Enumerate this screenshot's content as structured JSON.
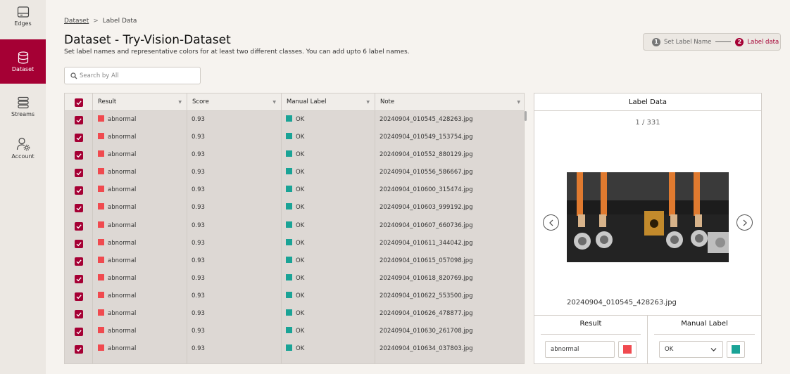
{
  "sidebar": {
    "items": [
      {
        "label": "Edges",
        "icon": "edge-device-icon",
        "active": false
      },
      {
        "label": "Dataset",
        "icon": "database-icon",
        "active": true
      },
      {
        "label": "Streams",
        "icon": "stack-icon",
        "active": false
      },
      {
        "label": "Account",
        "icon": "user-gear-icon",
        "active": false
      }
    ]
  },
  "breadcrumb": {
    "root": "Dataset",
    "separator": ">",
    "current": "Label Data"
  },
  "header": {
    "title": "Dataset - Try-Vision-Dataset",
    "subtitle": "Set label names and representative colors for at least two different classes. You can add upto 6 label names."
  },
  "stepper": {
    "step1": {
      "num": "1",
      "label": "Set Label Name"
    },
    "step2": {
      "num": "2",
      "label": "Label data"
    }
  },
  "search": {
    "placeholder": "Search by All"
  },
  "table": {
    "columns": [
      "Result",
      "Score",
      "Manual Label",
      "Note"
    ],
    "rows": [
      {
        "result": "abnormal",
        "score": "0.93",
        "manual": "OK",
        "note": "20240904_010545_428263.jpg"
      },
      {
        "result": "abnormal",
        "score": "0.93",
        "manual": "OK",
        "note": "20240904_010549_153754.jpg"
      },
      {
        "result": "abnormal",
        "score": "0.93",
        "manual": "OK",
        "note": "20240904_010552_880129.jpg"
      },
      {
        "result": "abnormal",
        "score": "0.93",
        "manual": "OK",
        "note": "20240904_010556_586667.jpg"
      },
      {
        "result": "abnormal",
        "score": "0.93",
        "manual": "OK",
        "note": "20240904_010600_315474.jpg"
      },
      {
        "result": "abnormal",
        "score": "0.93",
        "manual": "OK",
        "note": "20240904_010603_999192.jpg"
      },
      {
        "result": "abnormal",
        "score": "0.93",
        "manual": "OK",
        "note": "20240904_010607_660736.jpg"
      },
      {
        "result": "abnormal",
        "score": "0.93",
        "manual": "OK",
        "note": "20240904_010611_344042.jpg"
      },
      {
        "result": "abnormal",
        "score": "0.93",
        "manual": "OK",
        "note": "20240904_010615_057098.jpg"
      },
      {
        "result": "abnormal",
        "score": "0.93",
        "manual": "OK",
        "note": "20240904_010618_820769.jpg"
      },
      {
        "result": "abnormal",
        "score": "0.93",
        "manual": "OK",
        "note": "20240904_010622_553500.jpg"
      },
      {
        "result": "abnormal",
        "score": "0.93",
        "manual": "OK",
        "note": "20240904_010626_478877.jpg"
      },
      {
        "result": "abnormal",
        "score": "0.93",
        "manual": "OK",
        "note": "20240904_010630_261708.jpg"
      },
      {
        "result": "abnormal",
        "score": "0.93",
        "manual": "OK",
        "note": "20240904_010634_037803.jpg"
      }
    ]
  },
  "panel": {
    "title": "Label Data",
    "counter": "1 / 331",
    "filename": "20240904_010545_428263.jpg",
    "result_title": "Result",
    "result_value": "abnormal",
    "manual_title": "Manual Label",
    "manual_value": "OK"
  },
  "colors": {
    "accent": "#a50034",
    "abnormal": "#f04a4f",
    "ok": "#1aa396"
  }
}
